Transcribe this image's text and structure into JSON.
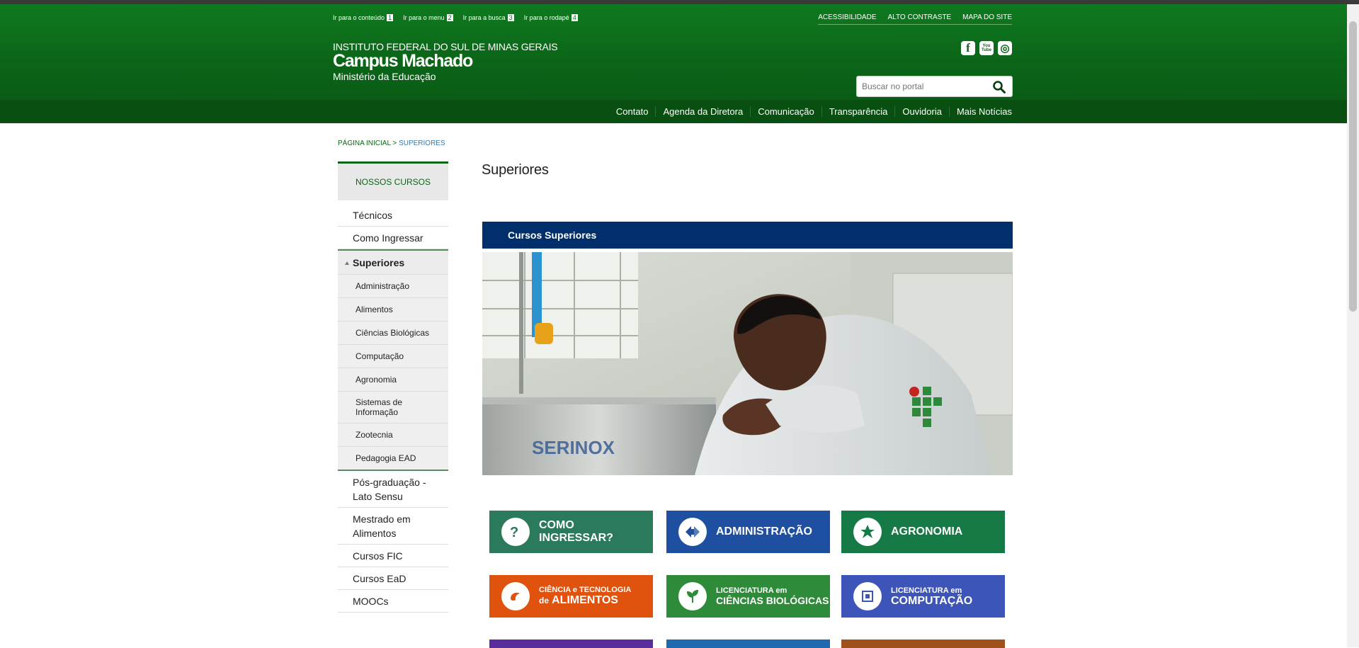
{
  "skip_links": [
    {
      "label": "Ir para o conteúdo",
      "num": "1"
    },
    {
      "label": "Ir para o menu",
      "num": "2"
    },
    {
      "label": "Ir para a busca",
      "num": "3"
    },
    {
      "label": "Ir para o rodapé",
      "num": "4"
    }
  ],
  "top_links": [
    "ACESSIBILIDADE",
    "ALTO CONTRASTE",
    "MAPA DO SITE"
  ],
  "institution": {
    "line1": "INSTITUTO FEDERAL DO SUL DE MINAS GERAIS",
    "line2": "Campus Machado",
    "line3": "Ministério da Educação"
  },
  "social": {
    "facebook": "f",
    "youtube": "You Tube",
    "instagram": "◎"
  },
  "search": {
    "placeholder": "Buscar no portal"
  },
  "menu": [
    "Contato",
    "Agenda da Diretora",
    "Comunicação",
    "Transparência",
    "Ouvidoria",
    "Mais Notícias"
  ],
  "breadcrumb": {
    "home": "PÁGINA INICIAL",
    "sep": " > ",
    "current": "SUPERIORES"
  },
  "sidebar": {
    "heading": "NOSSOS CURSOS",
    "items_top": [
      "Técnicos",
      "Como Ingressar"
    ],
    "selected": "Superiores",
    "sub_items": [
      "Administração",
      "Alimentos",
      "Ciências Biológicas",
      "Computação",
      "Agronomia",
      "Sistemas de Informação",
      "Zootecnia",
      "Pedagogia EAD"
    ],
    "items_bottom": [
      "Pós-graduação - Lato Sensu",
      "Mestrado em Alimentos",
      "Cursos FIC",
      "Cursos EaD",
      "MOOCs"
    ]
  },
  "page_title": "Superiores",
  "section_bar": "Cursos Superiores",
  "photo_text": "SERINOX",
  "tiles": [
    {
      "line1": "COMO",
      "line2": "INGRESSAR?",
      "color": "#2c7a5c"
    },
    {
      "line1": "ADMINISTRAÇÃO",
      "line2": "",
      "color": "#1f4fa0"
    },
    {
      "line1": "AGRONOMIA",
      "line2": "",
      "color": "#157a45"
    },
    {
      "small": "CIÊNCIA e TECNOLOGIA",
      "small2": "de",
      "big": "ALIMENTOS",
      "color": "#e0530f"
    },
    {
      "small": "LICENCIATURA em",
      "big": "CIÊNCIAS BIOLÓGICAS",
      "color": "#2e8b3a"
    },
    {
      "small": "LICENCIATURA em",
      "big": "COMPUTAÇÃO",
      "color": "#3d55b8"
    }
  ]
}
